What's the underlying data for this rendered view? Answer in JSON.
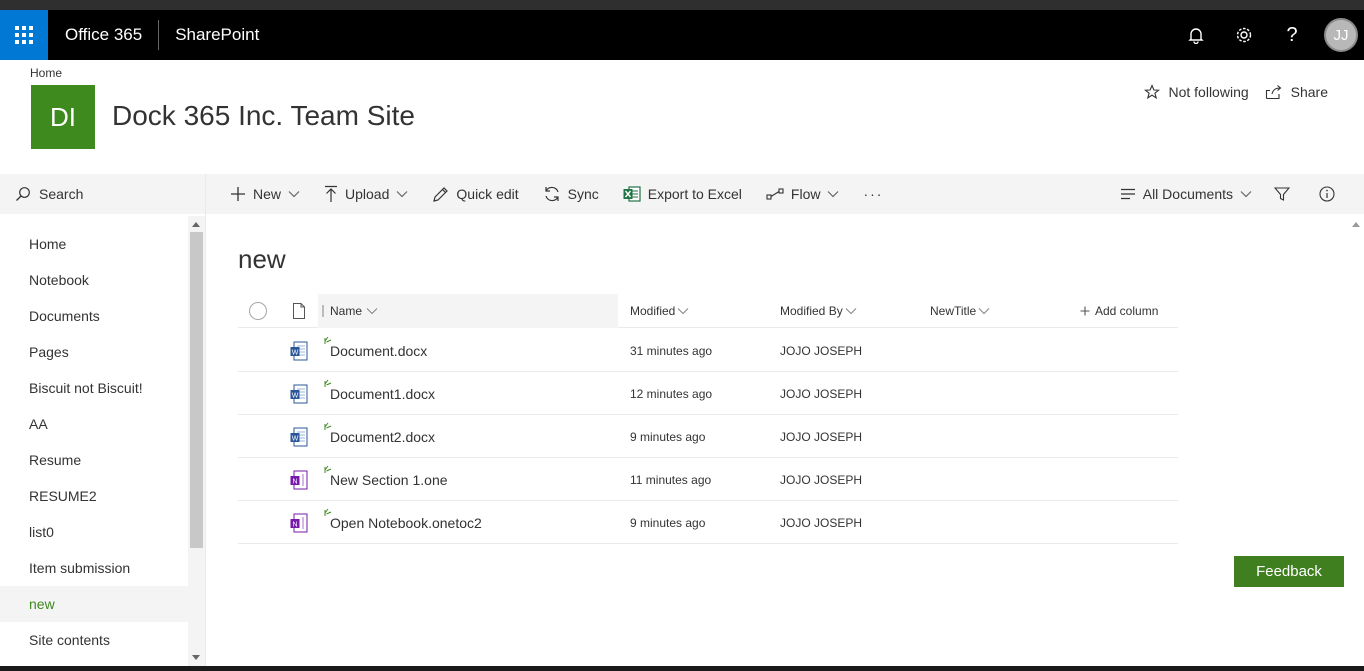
{
  "suite": {
    "brand": "Office 365",
    "app": "SharePoint",
    "avatar_initials": "JJ"
  },
  "header": {
    "breadcrumb": "Home",
    "logo_initials": "DI",
    "site_title": "Dock 365 Inc. Team Site",
    "follow_label": "Not following",
    "share_label": "Share"
  },
  "nav": {
    "search_label": "Search",
    "items": [
      "Home",
      "Notebook",
      "Documents",
      "Pages",
      "Biscuit not Biscuit!",
      "AA",
      "Resume",
      "RESUME2",
      "list0",
      "Item submission",
      "new",
      "Site contents"
    ],
    "selected": "new"
  },
  "commands": {
    "new": "New",
    "upload": "Upload",
    "quick_edit": "Quick edit",
    "sync": "Sync",
    "export": "Export to Excel",
    "flow": "Flow",
    "more": "···",
    "view": "All Documents"
  },
  "list": {
    "title": "new",
    "columns": {
      "name": "Name",
      "modified": "Modified",
      "modified_by": "Modified By",
      "new_title": "NewTitle",
      "add_column": "Add column"
    },
    "rows": [
      {
        "name": "Document.docx",
        "modified": "31 minutes ago",
        "modified_by": "JOJO JOSEPH",
        "icon": "word-doc-icon"
      },
      {
        "name": "Document1.docx",
        "modified": "12 minutes ago",
        "modified_by": "JOJO JOSEPH",
        "icon": "word-doc-icon"
      },
      {
        "name": "Document2.docx",
        "modified": "9 minutes ago",
        "modified_by": "JOJO JOSEPH",
        "icon": "word-doc-icon"
      },
      {
        "name": "New Section 1.one",
        "modified": "11 minutes ago",
        "modified_by": "JOJO JOSEPH",
        "icon": "onenote-section-icon"
      },
      {
        "name": "Open Notebook.onetoc2",
        "modified": "9 minutes ago",
        "modified_by": "JOJO JOSEPH",
        "icon": "onenote-notebook-icon"
      }
    ]
  },
  "feedback_label": "Feedback",
  "colors": {
    "suite_bg": "#000000",
    "waffle": "#0078d4",
    "accent_green": "#3f8a1f",
    "feedback_green": "#3f7f1f",
    "word_blue": "#2b579a",
    "onenote_purple": "#7719aa"
  }
}
